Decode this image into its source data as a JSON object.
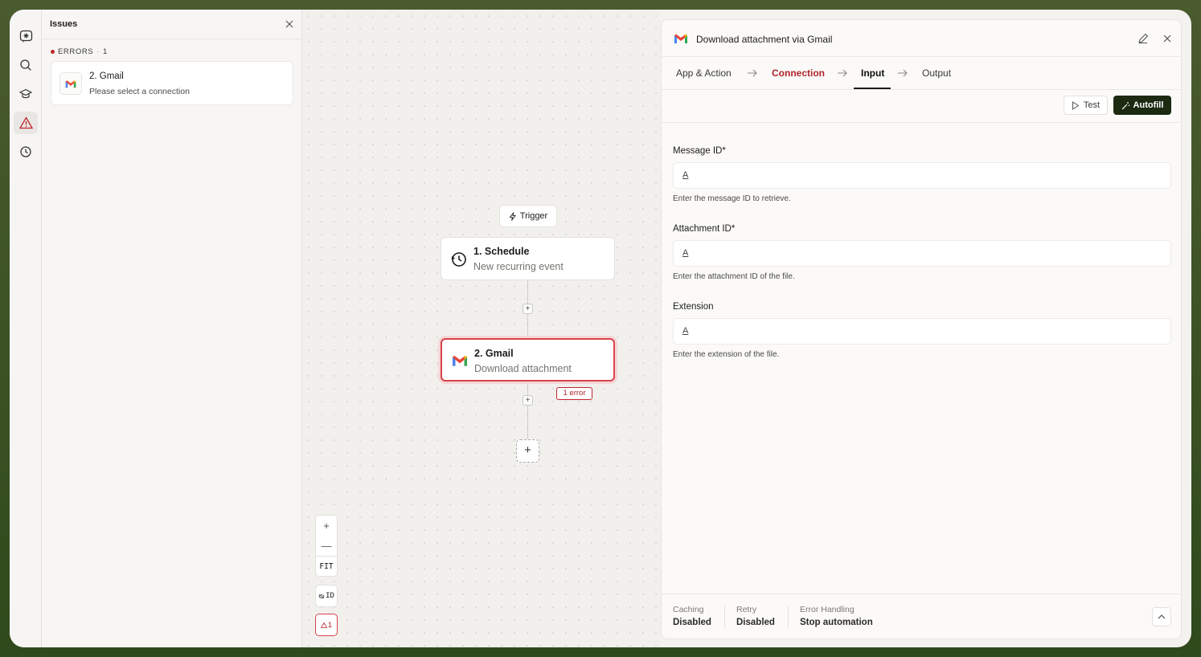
{
  "rail": {
    "items": [
      {
        "icon": "sparkle-chat-icon"
      },
      {
        "icon": "search-icon"
      },
      {
        "icon": "graduation-cap-icon"
      },
      {
        "icon": "warning-icon",
        "active": true
      },
      {
        "icon": "history-icon"
      }
    ]
  },
  "issues": {
    "title": "Issues",
    "errors_label": "ERRORS",
    "errors_sep": "·",
    "errors_count": "1",
    "items": [
      {
        "title": "2. Gmail",
        "subtitle": "Please select a connection"
      }
    ]
  },
  "canvas": {
    "trigger_label": "Trigger",
    "nodes": [
      {
        "title": "1. Schedule",
        "subtitle": "New recurring event"
      },
      {
        "title": "2. Gmail",
        "subtitle": "Download attachment",
        "error_badge": "1 error"
      }
    ],
    "add_symbol": "+",
    "zoom": {
      "plus": "+",
      "minus": "—",
      "fit": "FIT"
    },
    "id_toggle": "ID",
    "error_count": "1"
  },
  "panel": {
    "title": "Download attachment via Gmail",
    "tabs": [
      {
        "label": "App & Action",
        "state": "normal"
      },
      {
        "label": "Connection",
        "state": "error"
      },
      {
        "label": "Input",
        "state": "active"
      },
      {
        "label": "Output",
        "state": "normal"
      }
    ],
    "test_label": "Test",
    "autofill_label": "Autofill",
    "fields": [
      {
        "label": "Message ID*",
        "type_icon": "A",
        "value": "",
        "help": "Enter the message ID to retrieve."
      },
      {
        "label": "Attachment ID*",
        "type_icon": "A",
        "value": "",
        "help": "Enter the attachment ID of the file."
      },
      {
        "label": "Extension",
        "type_icon": "A",
        "value": "",
        "help": "Enter the extension of the file."
      }
    ],
    "footer": [
      {
        "label": "Caching",
        "value": "Disabled"
      },
      {
        "label": "Retry",
        "value": "Disabled"
      },
      {
        "label": "Error Handling",
        "value": "Stop automation"
      }
    ]
  },
  "colors": {
    "error": "#c0262d",
    "accent_dark": "#1c2a12",
    "frame_bg": "#3a5224"
  }
}
